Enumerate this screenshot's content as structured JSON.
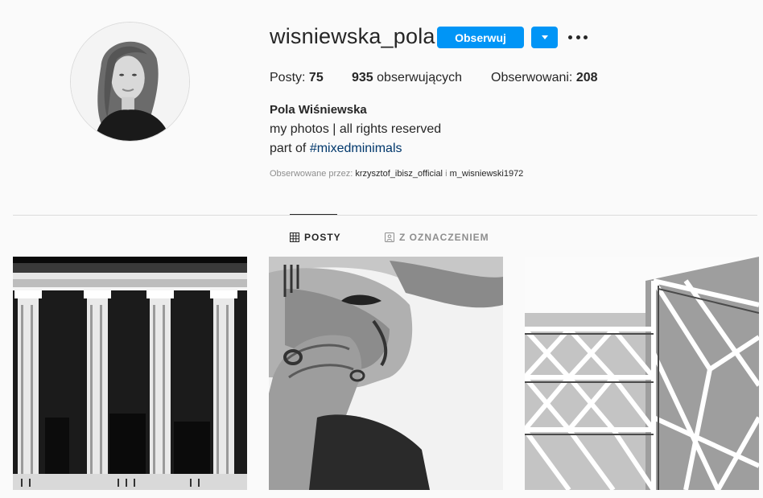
{
  "profile": {
    "username": "wisniewska_pola",
    "follow_label": "Obserwuj",
    "stats": {
      "posts_label": "Posty:",
      "posts_count": "75",
      "followers_count": "935",
      "followers_label": "obserwujących",
      "following_label": "Obserwowani:",
      "following_count": "208"
    },
    "full_name": "Pola Wiśniewska",
    "bio_line1": "my photos | all rights reserved",
    "bio_line2_prefix": "part of",
    "bio_hashtag": "#mixedminimals",
    "followed_by_label": "Obserwowane przez:",
    "followed_by_user1": "krzysztof_ibisz_official",
    "followed_by_sep": "i",
    "followed_by_user2": "m_wisniewski1972"
  },
  "tabs": [
    {
      "label": "POSTY",
      "icon": "grid-icon",
      "active": true
    },
    {
      "label": "Z OZNACZENIEM",
      "icon": "tag-portrait-icon",
      "active": false
    }
  ],
  "colors": {
    "accent": "#0095f6",
    "background": "#fafafa",
    "text": "#262626",
    "muted": "#8e8e8e",
    "hashtag": "#00376b"
  },
  "posts": [
    {
      "subject": "columns-photo"
    },
    {
      "subject": "portrait-photo"
    },
    {
      "subject": "architecture-photo"
    }
  ]
}
